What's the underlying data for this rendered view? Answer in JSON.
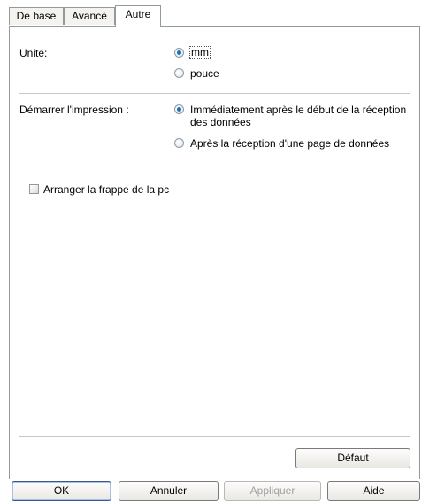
{
  "tabs": [
    {
      "label": "De base"
    },
    {
      "label": "Avancé"
    },
    {
      "label": "Autre",
      "active": true
    }
  ],
  "unit": {
    "label": "Unité:",
    "options": [
      {
        "label": "mm",
        "checked": true
      },
      {
        "label": "pouce",
        "checked": false
      }
    ]
  },
  "start_print": {
    "label": "Démarrer l'impression :",
    "options": [
      {
        "label_line1": "Immédiatement après le début de la réception",
        "label_line2": "des données",
        "checked": true
      },
      {
        "label": "Après la réception d'une page de données",
        "checked": false
      }
    ]
  },
  "arrange_checkbox": {
    "label": "Arranger la frappe de la pc",
    "checked": false
  },
  "default_button": {
    "label": "Défaut"
  },
  "footer": {
    "ok": "OK",
    "cancel": "Annuler",
    "apply": "Appliquer",
    "help": "Aide"
  }
}
